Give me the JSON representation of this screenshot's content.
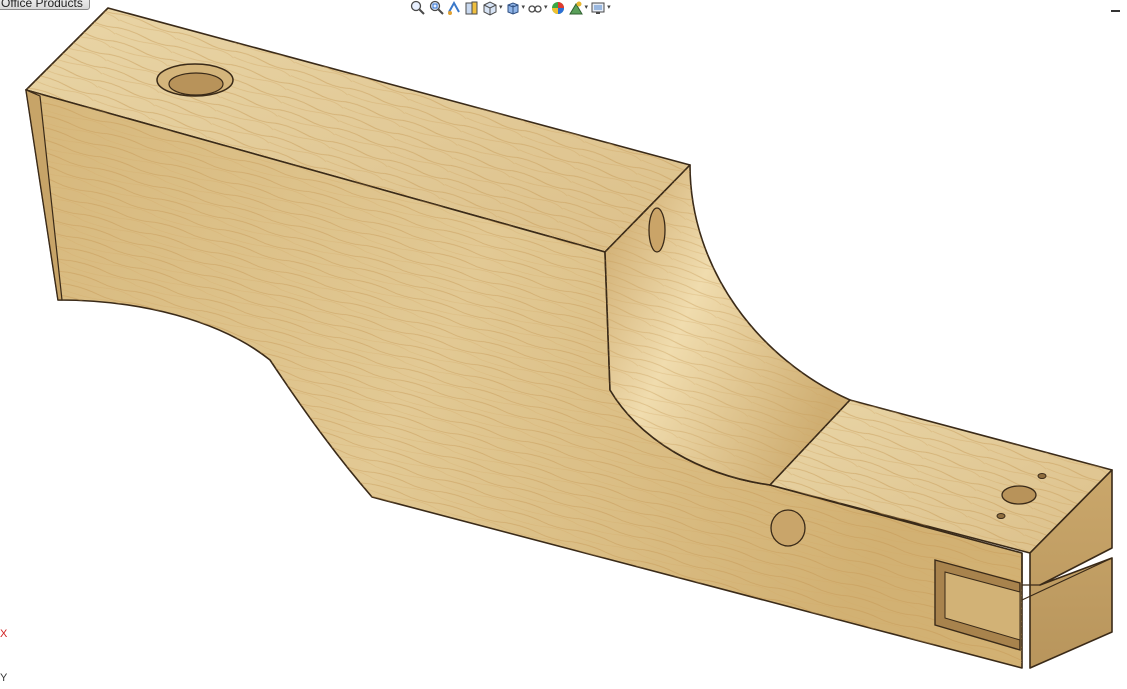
{
  "window": {
    "office_tab": "Office Products",
    "minimize_label": ""
  },
  "heads_up_toolbar": {
    "buttons": [
      {
        "name": "zoom-to-fit-icon",
        "has_dropdown": false
      },
      {
        "name": "zoom-to-area-icon",
        "has_dropdown": false
      },
      {
        "name": "previous-view-icon",
        "has_dropdown": false
      },
      {
        "name": "section-view-icon",
        "has_dropdown": false
      },
      {
        "name": "view-orientation-icon",
        "has_dropdown": true
      },
      {
        "name": "display-style-icon",
        "has_dropdown": true
      },
      {
        "name": "hide-show-items-icon",
        "has_dropdown": true
      },
      {
        "name": "edit-appearance-icon",
        "has_dropdown": false
      },
      {
        "name": "apply-scene-icon",
        "has_dropdown": true
      },
      {
        "name": "view-settings-icon",
        "has_dropdown": true
      }
    ],
    "caret": "▾"
  },
  "model": {
    "material": "wood",
    "colors": {
      "wood_light": "#e6cf9c",
      "wood_mid": "#d8b97c",
      "wood_dark": "#b99257",
      "grain": "#c89a55",
      "edge": "#3a2a18"
    }
  },
  "triad": {
    "x_label": "X",
    "y_label": "Y",
    "x_color": "#d02020"
  }
}
